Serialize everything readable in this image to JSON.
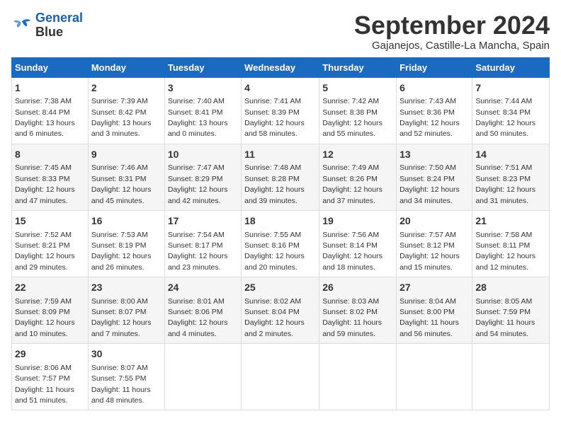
{
  "logo": {
    "line1": "General",
    "line2": "Blue"
  },
  "header": {
    "month": "September 2024",
    "location": "Gajanejos, Castille-La Mancha, Spain"
  },
  "days_of_week": [
    "Sunday",
    "Monday",
    "Tuesday",
    "Wednesday",
    "Thursday",
    "Friday",
    "Saturday"
  ],
  "weeks": [
    [
      {
        "day": 1,
        "sunrise": "7:38 AM",
        "sunset": "8:44 PM",
        "daylight": "13 hours and 6 minutes."
      },
      {
        "day": 2,
        "sunrise": "7:39 AM",
        "sunset": "8:42 PM",
        "daylight": "13 hours and 3 minutes."
      },
      {
        "day": 3,
        "sunrise": "7:40 AM",
        "sunset": "8:41 PM",
        "daylight": "13 hours and 0 minutes."
      },
      {
        "day": 4,
        "sunrise": "7:41 AM",
        "sunset": "8:39 PM",
        "daylight": "12 hours and 58 minutes."
      },
      {
        "day": 5,
        "sunrise": "7:42 AM",
        "sunset": "8:38 PM",
        "daylight": "12 hours and 55 minutes."
      },
      {
        "day": 6,
        "sunrise": "7:43 AM",
        "sunset": "8:36 PM",
        "daylight": "12 hours and 52 minutes."
      },
      {
        "day": 7,
        "sunrise": "7:44 AM",
        "sunset": "8:34 PM",
        "daylight": "12 hours and 50 minutes."
      }
    ],
    [
      {
        "day": 8,
        "sunrise": "7:45 AM",
        "sunset": "8:33 PM",
        "daylight": "12 hours and 47 minutes."
      },
      {
        "day": 9,
        "sunrise": "7:46 AM",
        "sunset": "8:31 PM",
        "daylight": "12 hours and 45 minutes."
      },
      {
        "day": 10,
        "sunrise": "7:47 AM",
        "sunset": "8:29 PM",
        "daylight": "12 hours and 42 minutes."
      },
      {
        "day": 11,
        "sunrise": "7:48 AM",
        "sunset": "8:28 PM",
        "daylight": "12 hours and 39 minutes."
      },
      {
        "day": 12,
        "sunrise": "7:49 AM",
        "sunset": "8:26 PM",
        "daylight": "12 hours and 37 minutes."
      },
      {
        "day": 13,
        "sunrise": "7:50 AM",
        "sunset": "8:24 PM",
        "daylight": "12 hours and 34 minutes."
      },
      {
        "day": 14,
        "sunrise": "7:51 AM",
        "sunset": "8:23 PM",
        "daylight": "12 hours and 31 minutes."
      }
    ],
    [
      {
        "day": 15,
        "sunrise": "7:52 AM",
        "sunset": "8:21 PM",
        "daylight": "12 hours and 29 minutes."
      },
      {
        "day": 16,
        "sunrise": "7:53 AM",
        "sunset": "8:19 PM",
        "daylight": "12 hours and 26 minutes."
      },
      {
        "day": 17,
        "sunrise": "7:54 AM",
        "sunset": "8:17 PM",
        "daylight": "12 hours and 23 minutes."
      },
      {
        "day": 18,
        "sunrise": "7:55 AM",
        "sunset": "8:16 PM",
        "daylight": "12 hours and 20 minutes."
      },
      {
        "day": 19,
        "sunrise": "7:56 AM",
        "sunset": "8:14 PM",
        "daylight": "12 hours and 18 minutes."
      },
      {
        "day": 20,
        "sunrise": "7:57 AM",
        "sunset": "8:12 PM",
        "daylight": "12 hours and 15 minutes."
      },
      {
        "day": 21,
        "sunrise": "7:58 AM",
        "sunset": "8:11 PM",
        "daylight": "12 hours and 12 minutes."
      }
    ],
    [
      {
        "day": 22,
        "sunrise": "7:59 AM",
        "sunset": "8:09 PM",
        "daylight": "12 hours and 10 minutes."
      },
      {
        "day": 23,
        "sunrise": "8:00 AM",
        "sunset": "8:07 PM",
        "daylight": "12 hours and 7 minutes."
      },
      {
        "day": 24,
        "sunrise": "8:01 AM",
        "sunset": "8:06 PM",
        "daylight": "12 hours and 4 minutes."
      },
      {
        "day": 25,
        "sunrise": "8:02 AM",
        "sunset": "8:04 PM",
        "daylight": "12 hours and 2 minutes."
      },
      {
        "day": 26,
        "sunrise": "8:03 AM",
        "sunset": "8:02 PM",
        "daylight": "11 hours and 59 minutes."
      },
      {
        "day": 27,
        "sunrise": "8:04 AM",
        "sunset": "8:00 PM",
        "daylight": "11 hours and 56 minutes."
      },
      {
        "day": 28,
        "sunrise": "8:05 AM",
        "sunset": "7:59 PM",
        "daylight": "11 hours and 54 minutes."
      }
    ],
    [
      {
        "day": 29,
        "sunrise": "8:06 AM",
        "sunset": "7:57 PM",
        "daylight": "11 hours and 51 minutes."
      },
      {
        "day": 30,
        "sunrise": "8:07 AM",
        "sunset": "7:55 PM",
        "daylight": "11 hours and 48 minutes."
      },
      null,
      null,
      null,
      null,
      null
    ]
  ],
  "labels": {
    "sunrise": "Sunrise:",
    "sunset": "Sunset:",
    "daylight": "Daylight:"
  }
}
